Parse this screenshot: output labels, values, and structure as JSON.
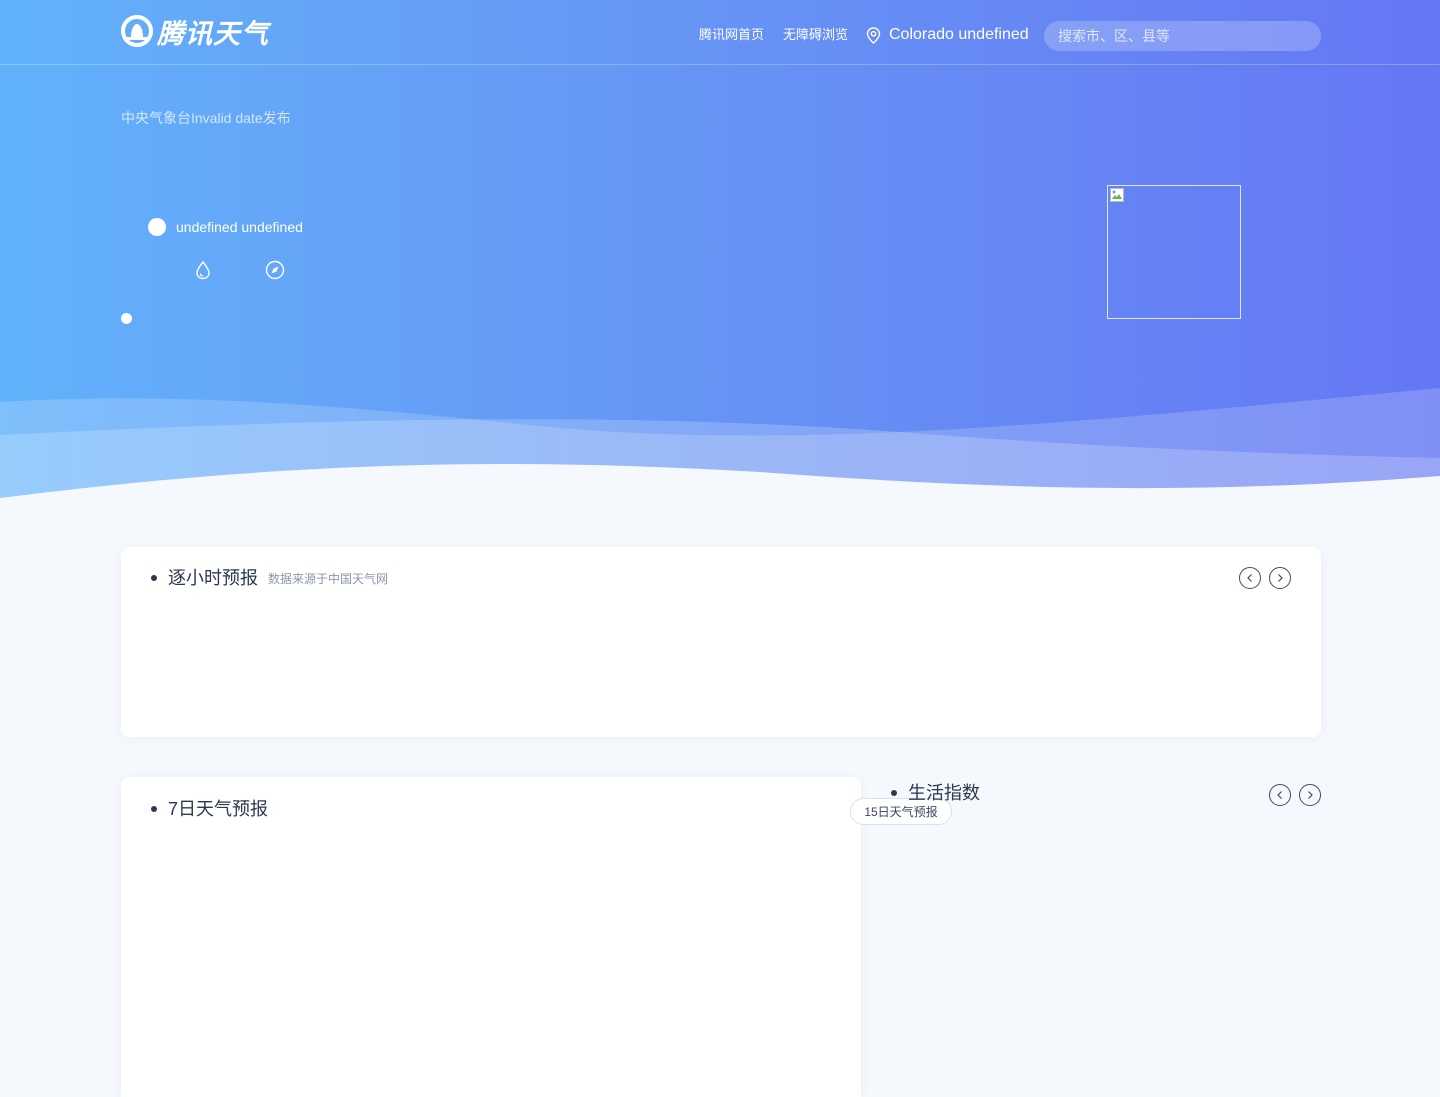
{
  "header": {
    "logo_text": "腾讯天气",
    "nav": {
      "home": "腾讯网首页",
      "accessible": "无障碍浏览"
    },
    "location": "Colorado undefined",
    "search_placeholder": "搜索市、区、县等"
  },
  "hero": {
    "publish_text": "中央气象台Invalid date发布",
    "condition_text": "undefined undefined",
    "icons": [
      "humidity-drop-icon",
      "compass-icon"
    ]
  },
  "hourly": {
    "title": "逐小时预报",
    "source": "数据来源于中国天气网"
  },
  "week": {
    "title": "7日天气预报",
    "more_button": "15日天气预报"
  },
  "life": {
    "title": "生活指数"
  },
  "colors": {
    "gradient_start": "#62b2fb",
    "gradient_end": "#6577f4",
    "page_bg": "#f5f8fc",
    "text_dark": "#2c3850"
  }
}
